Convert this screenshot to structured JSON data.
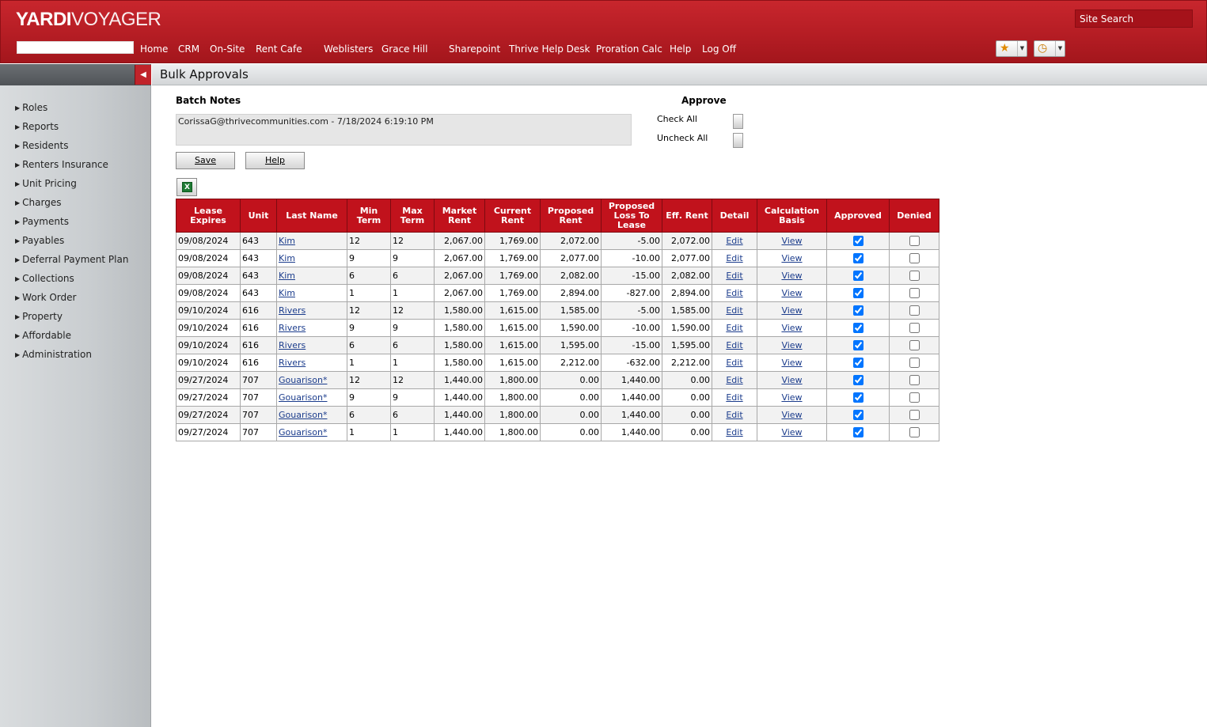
{
  "app": {
    "brand": "YARDI",
    "product": "VOYAGER",
    "site_search_placeholder": "Site Search"
  },
  "topnav": [
    "Home",
    "CRM",
    "On-Site",
    "Rent Cafe",
    "Weblisters",
    "Grace Hill",
    "Sharepoint",
    "Thrive Help Desk",
    "Proration Calc",
    "Help",
    "Log Off"
  ],
  "sidebar": {
    "items": [
      "Roles",
      "Reports",
      "Residents",
      "Renters Insurance",
      "Unit Pricing",
      "Charges",
      "Payments",
      "Payables",
      "Deferral Payment Plan",
      "Collections",
      "Work Order",
      "Property",
      "Affordable",
      "Administration"
    ]
  },
  "page": {
    "title": "Bulk Approvals",
    "batch_notes_label": "Batch Notes",
    "batch_notes_value": "CorissaG@thrivecommunities.com - 7/18/2024 6:19:10 PM",
    "approve_label": "Approve",
    "check_all": "Check All",
    "uncheck_all": "Uncheck All",
    "save_button": "Save",
    "help_button": "Help"
  },
  "table": {
    "headers": [
      "Lease Expires",
      "Unit",
      "Last Name",
      "Min Term",
      "Max Term",
      "Market Rent",
      "Current Rent",
      "Proposed Rent",
      "Proposed Loss To Lease",
      "Eff. Rent",
      "Detail",
      "Calculation Basis",
      "Approved",
      "Denied"
    ],
    "rows": [
      {
        "lease_expires": "09/08/2024",
        "unit": "643",
        "last_name": "Kim",
        "min_term": "12",
        "max_term": "12",
        "market_rent": "2,067.00",
        "current_rent": "1,769.00",
        "proposed_rent": "2,072.00",
        "loss_to_lease": "-5.00",
        "eff_rent": "2,072.00",
        "detail": "Edit",
        "calc_basis": "View",
        "approved": true,
        "denied": false
      },
      {
        "lease_expires": "09/08/2024",
        "unit": "643",
        "last_name": "Kim",
        "min_term": "9",
        "max_term": "9",
        "market_rent": "2,067.00",
        "current_rent": "1,769.00",
        "proposed_rent": "2,077.00",
        "loss_to_lease": "-10.00",
        "eff_rent": "2,077.00",
        "detail": "Edit",
        "calc_basis": "View",
        "approved": true,
        "denied": false
      },
      {
        "lease_expires": "09/08/2024",
        "unit": "643",
        "last_name": "Kim",
        "min_term": "6",
        "max_term": "6",
        "market_rent": "2,067.00",
        "current_rent": "1,769.00",
        "proposed_rent": "2,082.00",
        "loss_to_lease": "-15.00",
        "eff_rent": "2,082.00",
        "detail": "Edit",
        "calc_basis": "View",
        "approved": true,
        "denied": false
      },
      {
        "lease_expires": "09/08/2024",
        "unit": "643",
        "last_name": "Kim",
        "min_term": "1",
        "max_term": "1",
        "market_rent": "2,067.00",
        "current_rent": "1,769.00",
        "proposed_rent": "2,894.00",
        "loss_to_lease": "-827.00",
        "eff_rent": "2,894.00",
        "detail": "Edit",
        "calc_basis": "View",
        "approved": true,
        "denied": false
      },
      {
        "lease_expires": "09/10/2024",
        "unit": "616",
        "last_name": "Rivers",
        "min_term": "12",
        "max_term": "12",
        "market_rent": "1,580.00",
        "current_rent": "1,615.00",
        "proposed_rent": "1,585.00",
        "loss_to_lease": "-5.00",
        "eff_rent": "1,585.00",
        "detail": "Edit",
        "calc_basis": "View",
        "approved": true,
        "denied": false
      },
      {
        "lease_expires": "09/10/2024",
        "unit": "616",
        "last_name": "Rivers",
        "min_term": "9",
        "max_term": "9",
        "market_rent": "1,580.00",
        "current_rent": "1,615.00",
        "proposed_rent": "1,590.00",
        "loss_to_lease": "-10.00",
        "eff_rent": "1,590.00",
        "detail": "Edit",
        "calc_basis": "View",
        "approved": true,
        "denied": false
      },
      {
        "lease_expires": "09/10/2024",
        "unit": "616",
        "last_name": "Rivers",
        "min_term": "6",
        "max_term": "6",
        "market_rent": "1,580.00",
        "current_rent": "1,615.00",
        "proposed_rent": "1,595.00",
        "loss_to_lease": "-15.00",
        "eff_rent": "1,595.00",
        "detail": "Edit",
        "calc_basis": "View",
        "approved": true,
        "denied": false
      },
      {
        "lease_expires": "09/10/2024",
        "unit": "616",
        "last_name": "Rivers",
        "min_term": "1",
        "max_term": "1",
        "market_rent": "1,580.00",
        "current_rent": "1,615.00",
        "proposed_rent": "2,212.00",
        "loss_to_lease": "-632.00",
        "eff_rent": "2,212.00",
        "detail": "Edit",
        "calc_basis": "View",
        "approved": true,
        "denied": false
      },
      {
        "lease_expires": "09/27/2024",
        "unit": "707",
        "last_name": "Gouarison*",
        "min_term": "12",
        "max_term": "12",
        "market_rent": "1,440.00",
        "current_rent": "1,800.00",
        "proposed_rent": "0.00",
        "loss_to_lease": "1,440.00",
        "eff_rent": "0.00",
        "detail": "Edit",
        "calc_basis": "View",
        "approved": true,
        "denied": false
      },
      {
        "lease_expires": "09/27/2024",
        "unit": "707",
        "last_name": "Gouarison*",
        "min_term": "9",
        "max_term": "9",
        "market_rent": "1,440.00",
        "current_rent": "1,800.00",
        "proposed_rent": "0.00",
        "loss_to_lease": "1,440.00",
        "eff_rent": "0.00",
        "detail": "Edit",
        "calc_basis": "View",
        "approved": true,
        "denied": false
      },
      {
        "lease_expires": "09/27/2024",
        "unit": "707",
        "last_name": "Gouarison*",
        "min_term": "6",
        "max_term": "6",
        "market_rent": "1,440.00",
        "current_rent": "1,800.00",
        "proposed_rent": "0.00",
        "loss_to_lease": "1,440.00",
        "eff_rent": "0.00",
        "detail": "Edit",
        "calc_basis": "View",
        "approved": true,
        "denied": false
      },
      {
        "lease_expires": "09/27/2024",
        "unit": "707",
        "last_name": "Gouarison*",
        "min_term": "1",
        "max_term": "1",
        "market_rent": "1,440.00",
        "current_rent": "1,800.00",
        "proposed_rent": "0.00",
        "loss_to_lease": "1,440.00",
        "eff_rent": "0.00",
        "detail": "Edit",
        "calc_basis": "View",
        "approved": true,
        "denied": false
      }
    ]
  },
  "colors": {
    "header_red": "#c1121c",
    "link_blue": "#1b3c8c"
  },
  "icons": {
    "favorites": "star-icon",
    "history": "clock-icon",
    "excel": "excel-export-icon",
    "collapse": "triangle-left-icon",
    "menu_arrow": "triangle-right-icon"
  }
}
